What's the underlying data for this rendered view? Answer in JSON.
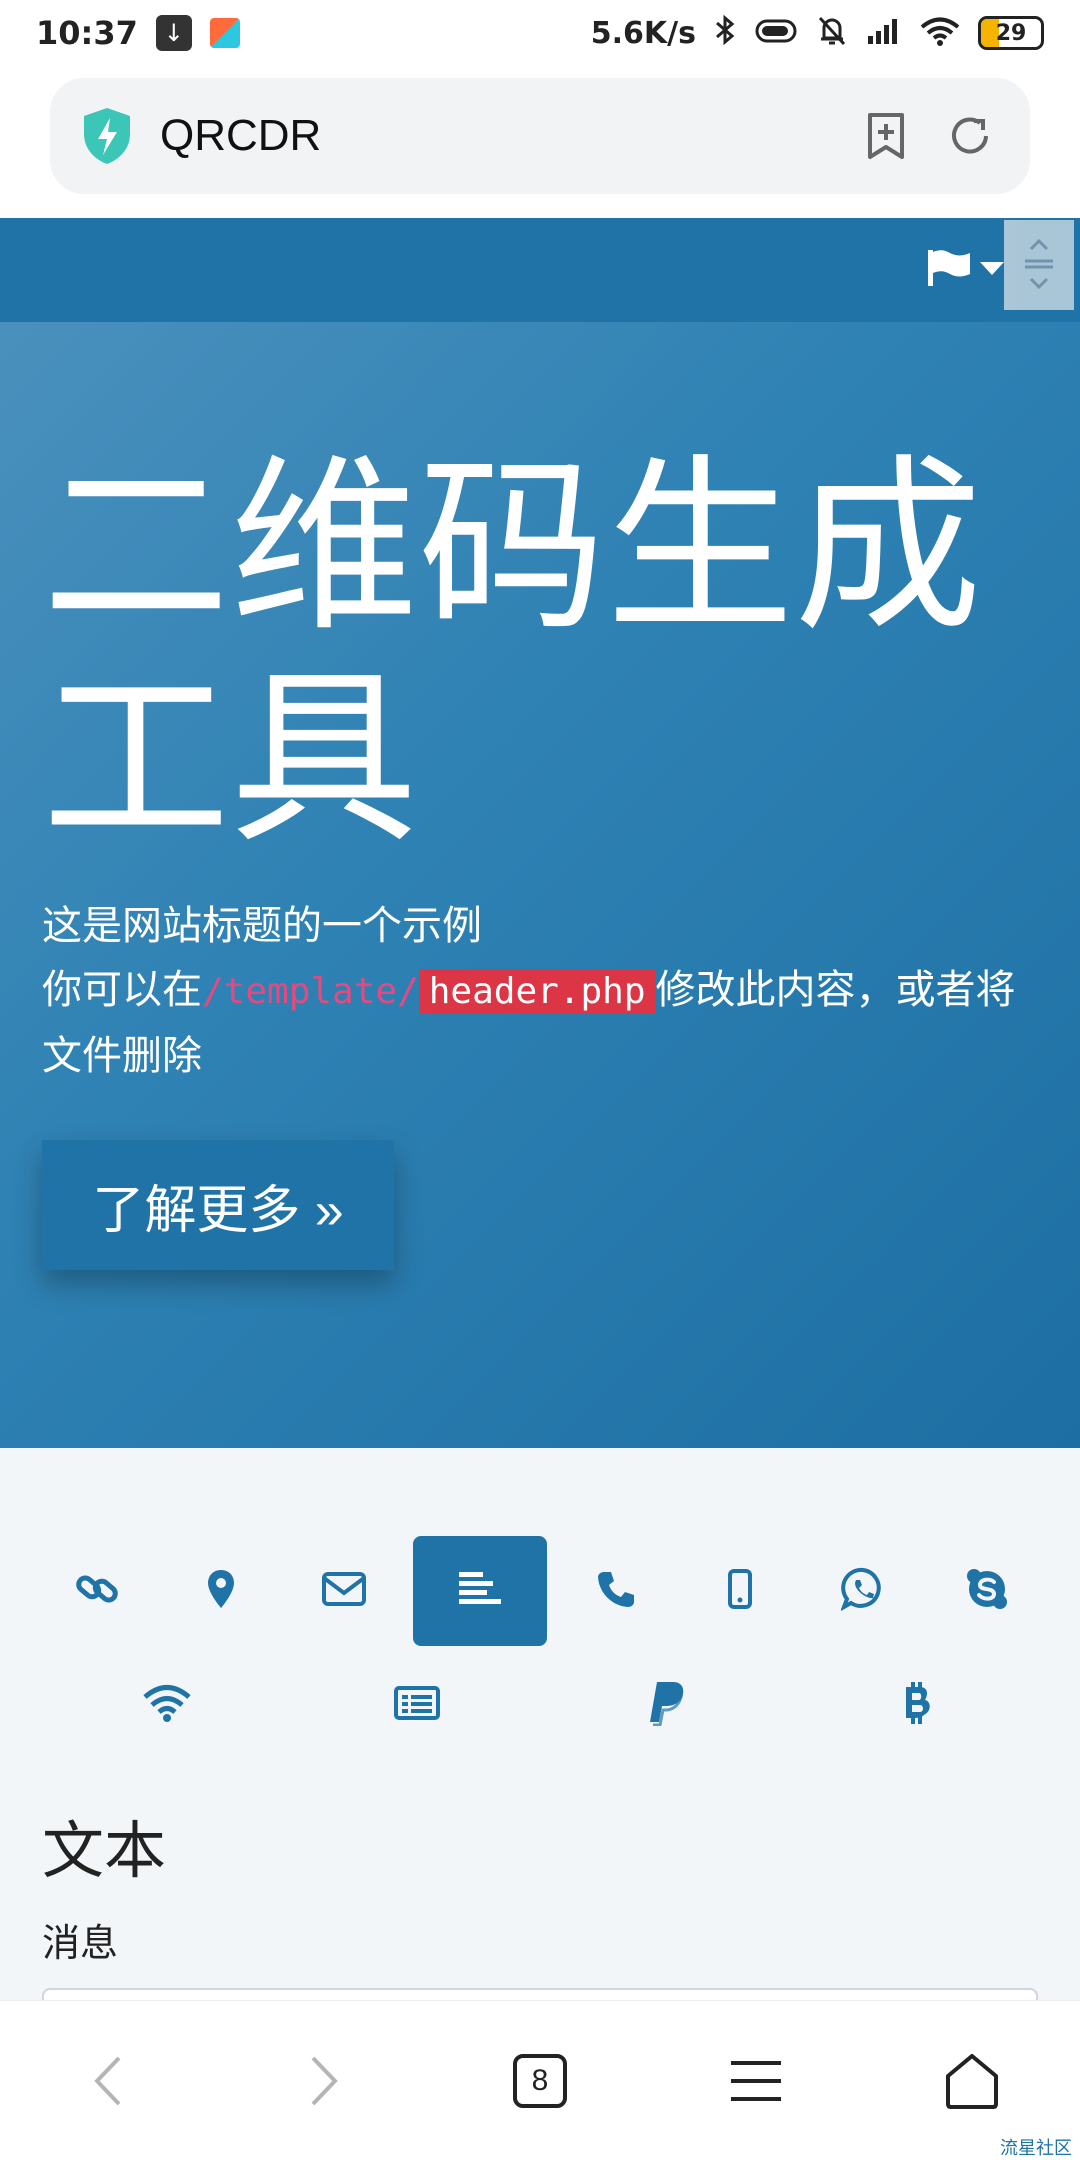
{
  "status_bar": {
    "time": "10:37",
    "net_speed": "5.6K/s",
    "battery": "29"
  },
  "browser": {
    "url_title": "QRCDR",
    "tabs_count": "8"
  },
  "hero": {
    "title": "二维码生成工具",
    "line1": "这是网站标题的一个示例",
    "line2_prefix": "你可以在",
    "code_path": "/template/",
    "code_file": "header.php",
    "line2_suffix": "修改此内容，或者将文件删除",
    "button_label": "了解更多 »"
  },
  "qr_types": {
    "row1": [
      "link-icon",
      "location-icon",
      "email-icon",
      "text-icon",
      "phone-icon",
      "mobile-icon",
      "whatsapp-icon",
      "skype-icon"
    ],
    "row2": [
      "wifi-icon",
      "vcard-icon",
      "paypal-icon",
      "bitcoin-icon"
    ],
    "active": "text-icon"
  },
  "form": {
    "section_title": "文本",
    "message_label": "消息"
  },
  "watermark": "流星社区",
  "colors": {
    "primary": "#1f73a7",
    "hero_start": "#4a90bd",
    "hero_end": "#1d6fa3",
    "code_pink": "#e64980",
    "code_red_bg": "#dc3545",
    "content_bg": "#f3f6f9"
  }
}
